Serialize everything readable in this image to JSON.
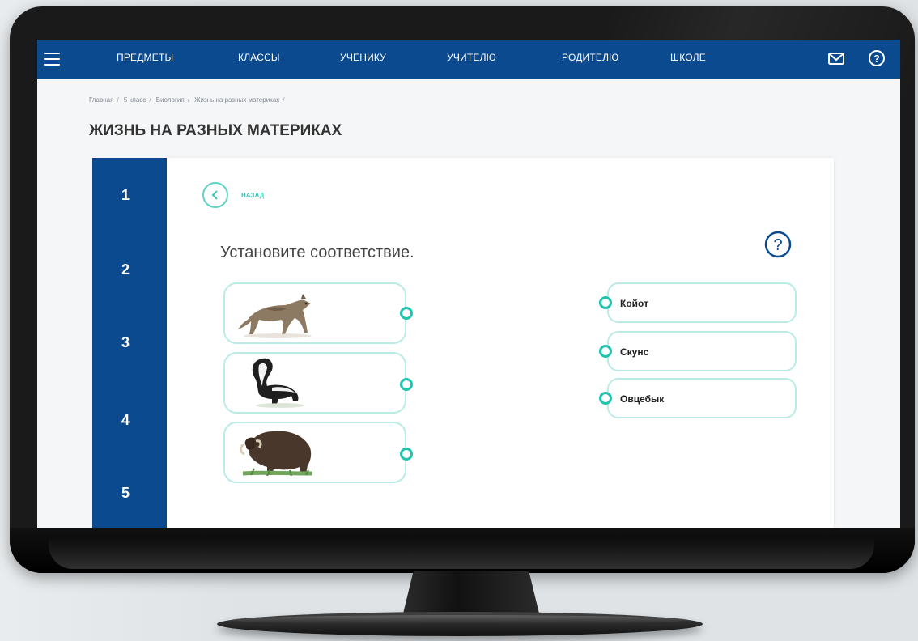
{
  "nav": {
    "items": [
      "ПРЕДМЕТЫ",
      "КЛАССЫ",
      "УЧЕНИКУ",
      "УЧИТЕЛЮ",
      "РОДИТЕЛЮ",
      "ШКОЛЕ"
    ],
    "icons": [
      "menu-icon",
      "mail-icon",
      "help-icon"
    ]
  },
  "breadcrumb": [
    "Главная",
    "5 класс",
    "Биология",
    "Жизнь на разных материках"
  ],
  "page_title": "ЖИЗНЬ НА РАЗНЫХ МАТЕРИКАХ",
  "steps": [
    "1",
    "2",
    "3",
    "4",
    "5"
  ],
  "back_label": "НАЗАД",
  "task_title": "Установите соответствие.",
  "left_items": [
    {
      "icon": "coyote-image"
    },
    {
      "icon": "skunk-image"
    },
    {
      "icon": "muskox-image"
    }
  ],
  "right_items": [
    "Койот",
    "Скунс",
    "Овцебык"
  ],
  "colors": {
    "nav_blue": "#0b4a8f",
    "accent_teal": "#20c3ae",
    "card_border": "#b9ece6"
  }
}
